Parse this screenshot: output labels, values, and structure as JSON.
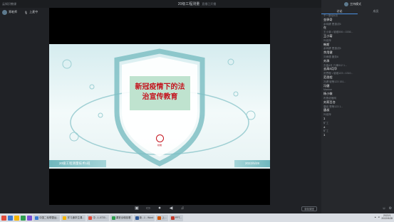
{
  "window": {
    "brand": "云知识教课",
    "title": "20级工程测量",
    "subtitle": "直播已开播",
    "controls": [
      "minimize-icon",
      "maximize-icon",
      "close-icon"
    ]
  },
  "userbar": {
    "user_name": "郑老师",
    "mic_label": "上麦中"
  },
  "slide": {
    "title_line1": "新冠疫情下的法",
    "title_line2": "治宣传教育",
    "footer_left": "20级工程测量技术1班",
    "footer_right": "2022/5/28",
    "logo_label": "校徽",
    "accent": "#c4141e",
    "ring": "#7fbfc4"
  },
  "toolbar": {
    "icons": [
      "camera-icon",
      "screen-share-icon",
      "microphone-icon",
      "speaker-icon",
      "music-icon"
    ],
    "record_label": "录制课堂"
  },
  "panel": {
    "host_name": "主持模式",
    "tabs": [
      "讨论",
      "成员"
    ],
    "messages": [
      {
        "who": "千一新动4月",
        "text": "金驿奇"
      },
      {
        "who": "余鸡健  恩惠试6",
        "text": "在"
      },
      {
        "who": "王小菊 • 坡维506 • 1536...",
        "text": "王小菊"
      },
      {
        "who": "叶叔萍",
        "text": "韩斯"
      },
      {
        "who": "余鸡健  恩惠试6",
        "text": "余用健"
      },
      {
        "who": "刘承德 服务6",
        "text": "刘承"
      },
      {
        "who": "去高4月 凡事512  1...",
        "text": "去高4月华"
      },
      {
        "who": "范思程 • 坡维123 • 1310...",
        "text": "范思程"
      },
      {
        "who": "冯健  坡等123  151...",
        "text": "冯健"
      },
      {
        "who": "Martine",
        "text": "杨小微"
      },
      {
        "who": "布鲁诺宿网",
        "text": "刘莉百合"
      },
      {
        "who": "唐叔  恩等123  1...",
        "text": "唐叔"
      },
      {
        "who": "叶叔萍",
        "text": "1"
      },
      {
        "who": "矿工",
        "text": "±"
      },
      {
        "who": "矿工",
        "text": "1"
      }
    ],
    "input_icons": [
      "emoji-icon",
      "settings-icon"
    ]
  },
  "taskbar": {
    "items": [
      "中国二轮联盟运...",
      "学习通学生课...",
      "中...1-0720...",
      "课堂全程回看",
      "新...1 - Word",
      "上...",
      "PPT..."
    ],
    "time": "2022/1",
    "date": "2022/5/28"
  }
}
